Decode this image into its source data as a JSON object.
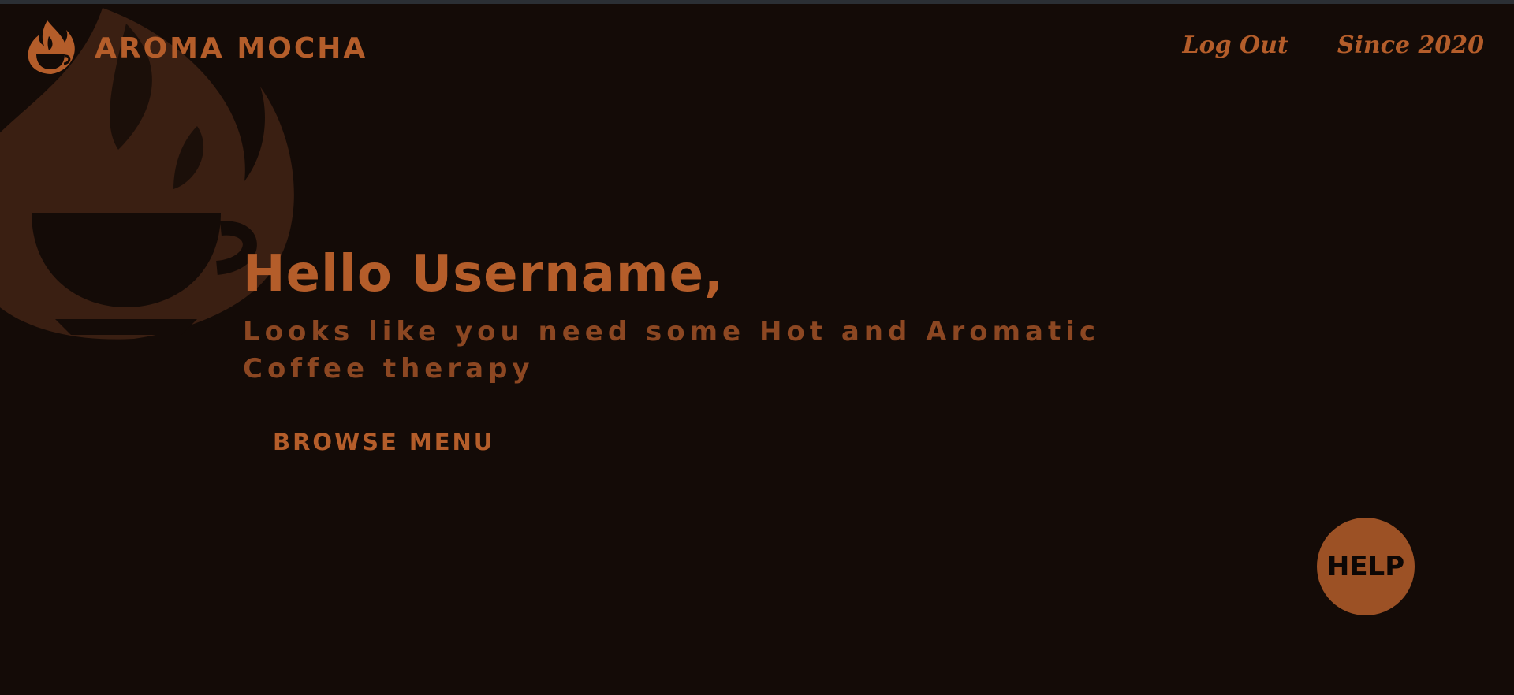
{
  "brand": {
    "name": "AROMA MOCHA",
    "logo_icon": "flame-coffee-cup-icon"
  },
  "nav": {
    "logout_label": "Log Out",
    "since_label": "Since 2020"
  },
  "hero": {
    "greeting": "Hello Username,",
    "tagline": "Looks like you need some Hot and Aromatic Coffee therapy",
    "browse_label": "BROWSE MENU"
  },
  "help": {
    "label": "HELP"
  },
  "colors": {
    "background": "#140b07",
    "accent": "#b45d2a",
    "accent_dark": "#8c4722",
    "help_bg": "#9c5125",
    "watermark": "#3a1f12"
  }
}
